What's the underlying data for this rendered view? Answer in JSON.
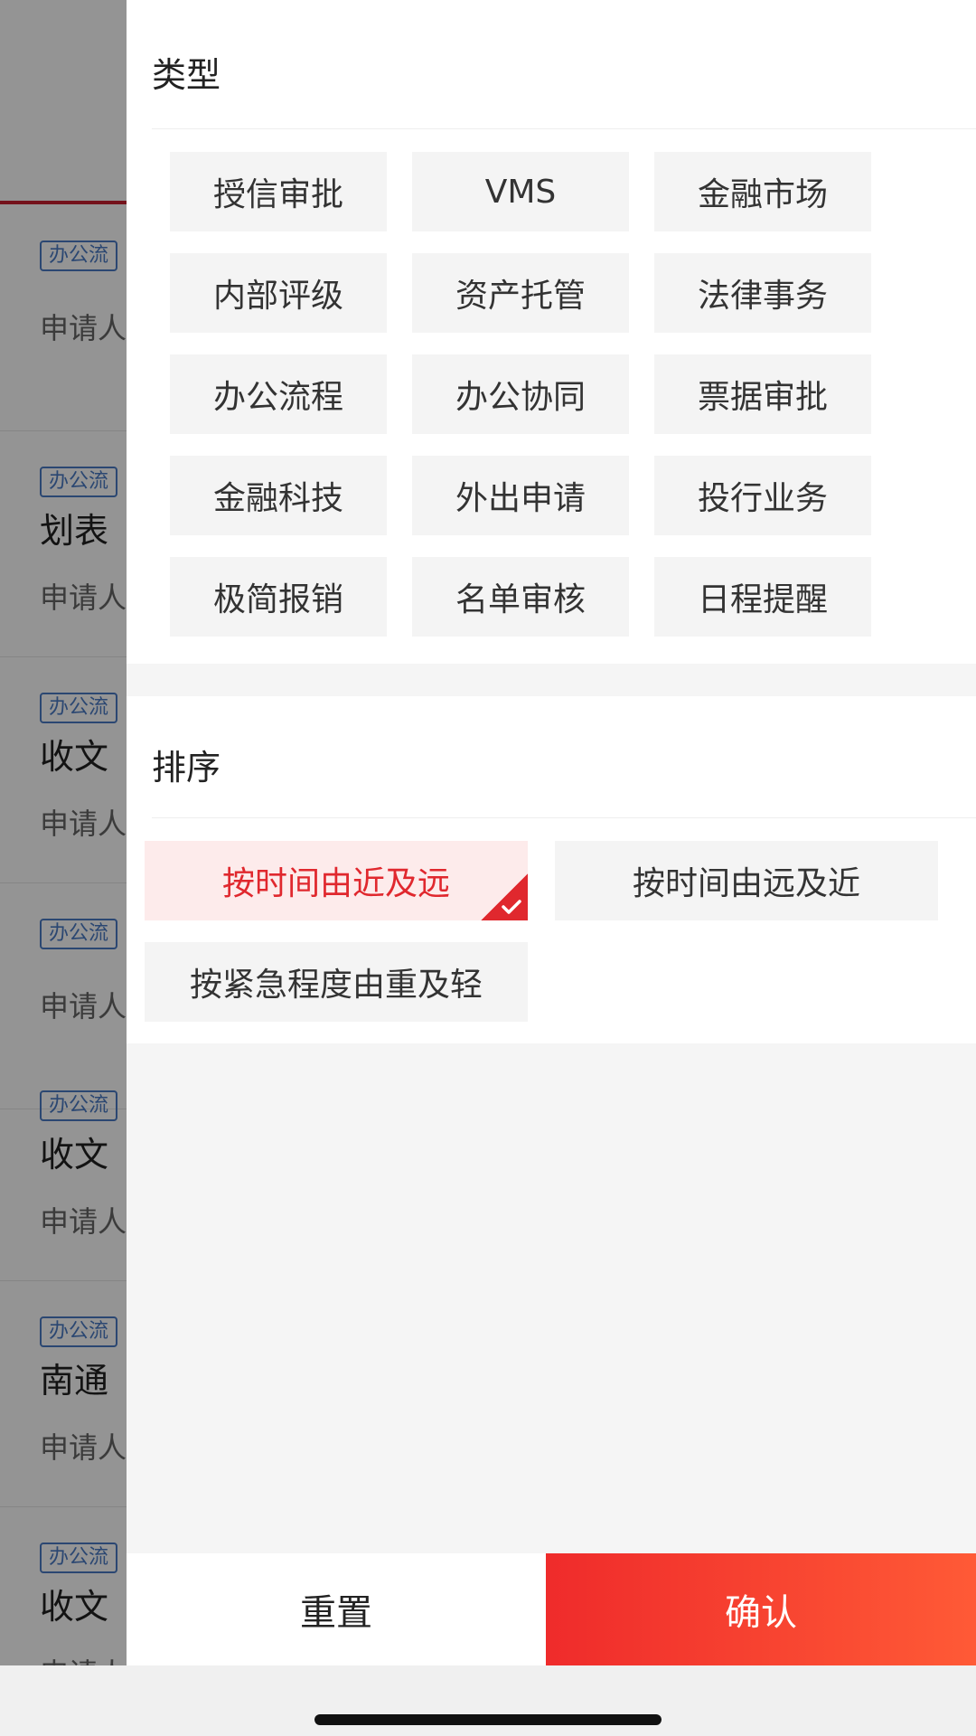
{
  "background_list": {
    "items": [
      {
        "tag": "办公流",
        "title": "",
        "meta": "申请人"
      },
      {
        "tag": "办公流",
        "title": "划表",
        "meta": "申请人"
      },
      {
        "tag": "办公流",
        "title": "收文",
        "meta": "申请人"
      },
      {
        "tag": "办公流",
        "title": "",
        "meta": "申请人"
      },
      {
        "tag": "办公流",
        "title": "收文",
        "meta": "申请人"
      },
      {
        "tag": "办公流",
        "title": "南通",
        "meta": "申请人"
      },
      {
        "tag": "办公流",
        "title": "收文",
        "meta": "申请人"
      }
    ]
  },
  "filter": {
    "type_section": {
      "title": "类型",
      "options": [
        "授信审批",
        "VMS",
        "金融市场",
        "内部评级",
        "资产托管",
        "法律事务",
        "办公流程",
        "办公协同",
        "票据审批",
        "金融科技",
        "外出申请",
        "投行业务",
        "极简报销",
        "名单审核",
        "日程提醒"
      ]
    },
    "sort_section": {
      "title": "排序",
      "options": [
        {
          "label": "按时间由近及远",
          "selected": true
        },
        {
          "label": "按时间由远及近",
          "selected": false
        },
        {
          "label": "按紧急程度由重及轻",
          "selected": false
        }
      ]
    }
  },
  "footer": {
    "reset_label": "重置",
    "confirm_label": "确认"
  },
  "colors": {
    "accent": "#e0282e",
    "confirm_gradient_start": "#ef2b2b",
    "confirm_gradient_end": "#ff5a36",
    "tag_blue": "#4a7bc4"
  },
  "icons": {
    "selected_mark": "check-icon"
  }
}
